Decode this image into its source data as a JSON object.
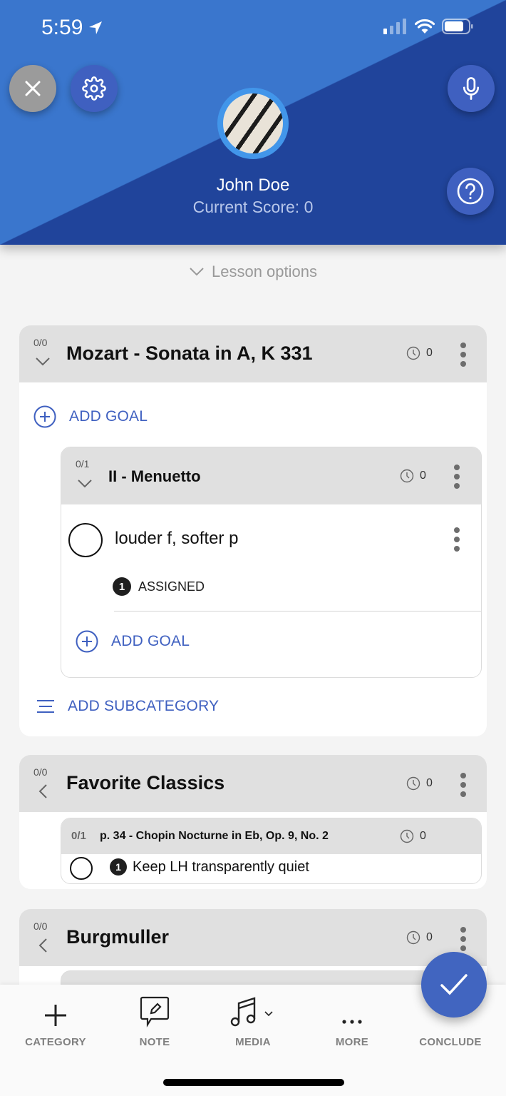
{
  "status_bar": {
    "time": "5:59"
  },
  "header": {
    "student_name": "John Doe",
    "score_text": "Current Score: 0",
    "colors": {
      "light_blue": "#3a76cd",
      "dark_blue": "#20449b",
      "button_blue": "#3f60c0",
      "close_gray": "#9b9b9b"
    }
  },
  "lesson_options_label": "Lesson options",
  "categories": [
    {
      "fraction": "0/0",
      "title": "Mozart - Sonata in A, K 331",
      "timer": "0",
      "expanded": true,
      "add_goal_label": "ADD GOAL",
      "subcategories": [
        {
          "fraction": "0/1",
          "title": "II - Menuetto",
          "timer": "0",
          "goals": [
            {
              "text": "louder f, softer p",
              "badge": "1",
              "status": "ASSIGNED"
            }
          ],
          "add_goal_label": "ADD GOAL"
        }
      ],
      "add_subcategory_label": "ADD SUBCATEGORY"
    },
    {
      "fraction": "0/0",
      "title": "Favorite Classics",
      "timer": "0",
      "expanded": false,
      "subcategories": [
        {
          "fraction": "0/1",
          "title": "p. 34 - Chopin Nocturne in Eb, Op. 9, No. 2",
          "timer": "0",
          "goals": [
            {
              "text": "Keep LH transparently quiet",
              "badge": "1"
            }
          ]
        }
      ]
    },
    {
      "fraction": "0/0",
      "title": "Burgmuller",
      "timer": "0",
      "expanded": false
    }
  ],
  "bottom_bar": {
    "tabs": [
      {
        "label": "CATEGORY",
        "icon": "plus-icon"
      },
      {
        "label": "NOTE",
        "icon": "note-icon"
      },
      {
        "label": "MEDIA",
        "icon": "music-icon"
      },
      {
        "label": "MORE",
        "icon": "more-icon"
      },
      {
        "label": "CONCLUDE",
        "icon": "check-icon"
      }
    ],
    "accent": "#4165c0"
  }
}
